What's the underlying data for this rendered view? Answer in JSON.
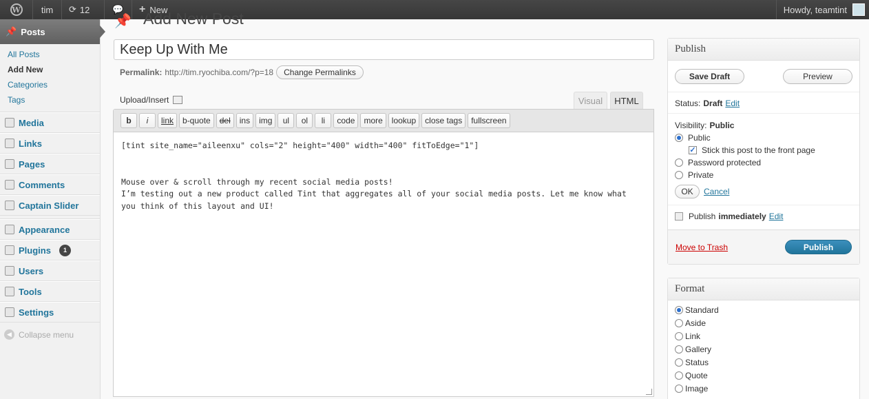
{
  "adminbar": {
    "site_name": "tim",
    "updates_count": "12",
    "new_label": "New",
    "howdy": "Howdy, teamtint"
  },
  "sidebar": {
    "posts_label": "Posts",
    "submenu": [
      "All Posts",
      "Add New",
      "Categories",
      "Tags"
    ],
    "items": [
      "Media",
      "Links",
      "Pages",
      "Comments",
      "Captain Slider"
    ],
    "items2": [
      "Appearance",
      "Plugins",
      "Users",
      "Tools",
      "Settings"
    ],
    "plugins_badge": "1",
    "collapse_label": "Collapse menu"
  },
  "page": {
    "heading": "Add New Post"
  },
  "post": {
    "title": "Keep Up With Me",
    "permalink_label": "Permalink:",
    "permalink_url": "http://tim.ryochiba.com/?p=18",
    "change_permalinks": "Change Permalinks",
    "upload_insert": "Upload/Insert",
    "tab_visual": "Visual",
    "tab_html": "HTML",
    "content": "[tint site_name=\"aileenxu\" cols=\"2\" height=\"400\" width=\"400\" fitToEdge=\"1\"]\n\n\nMouse over & scroll through my recent social media posts!\nI’m testing out a new product called Tint that aggregates all of your social media posts. Let me know what\nyou think of this layout and UI!"
  },
  "quicktags": [
    "b",
    "i",
    "link",
    "b-quote",
    "del",
    "ins",
    "img",
    "ul",
    "ol",
    "li",
    "code",
    "more",
    "lookup",
    "close tags",
    "fullscreen"
  ],
  "publish": {
    "title": "Publish",
    "save_draft": "Save Draft",
    "preview": "Preview",
    "status_label": "Status:",
    "status_value": "Draft",
    "edit": "Edit",
    "visibility_label": "Visibility:",
    "visibility_value": "Public",
    "opt_public": "Public",
    "opt_sticky": "Stick this post to the front page",
    "opt_password": "Password protected",
    "opt_private": "Private",
    "ok": "OK",
    "cancel": "Cancel",
    "publish_label": "Publish",
    "publish_when": "immediately",
    "move_trash": "Move to Trash",
    "publish_button": "Publish"
  },
  "format": {
    "title": "Format",
    "options": [
      "Standard",
      "Aside",
      "Link",
      "Gallery",
      "Status",
      "Quote",
      "Image"
    ],
    "selected": "Standard"
  }
}
